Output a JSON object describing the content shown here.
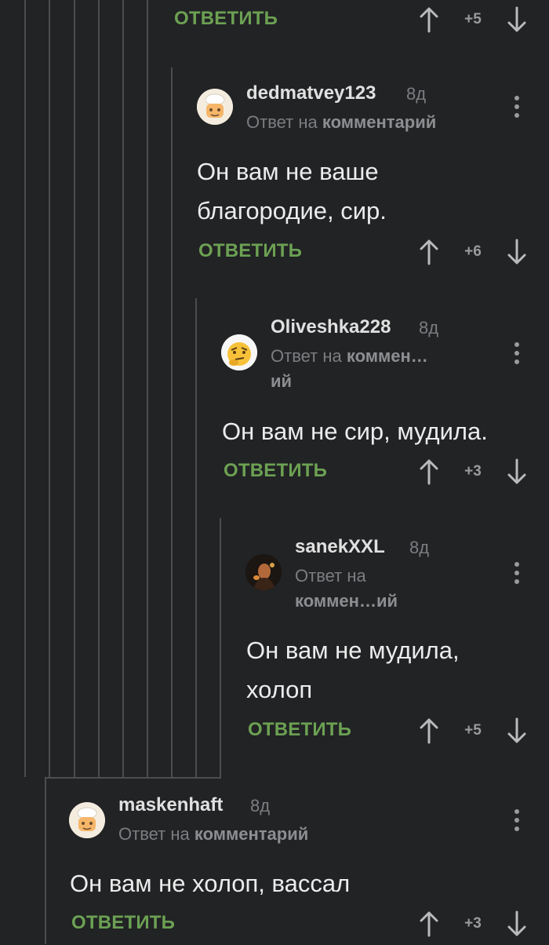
{
  "top_actions": {
    "reply": "ОТВЕТИТЬ",
    "score": "+5"
  },
  "comments": [
    {
      "author": "dedmatvey123",
      "time": "8д",
      "reply_prefix": "Ответ на",
      "reply_target": "комментарий",
      "text_lines": [
        "Он вам не ваше",
        "благородие, сир."
      ],
      "reply": "ОТВЕТИТЬ",
      "score": "+6",
      "avatar": "chef-avatar"
    },
    {
      "author": "Oliveshka228",
      "time": "8д",
      "reply_prefix": "Ответ на",
      "reply_target_line1": "коммен…",
      "reply_target_line2": "ий",
      "text_lines": [
        "Он вам не сир, мудила."
      ],
      "reply": "ОТВЕТИТЬ",
      "score": "+3",
      "avatar": "thinking-emoji-avatar"
    },
    {
      "author": "sanekXXL",
      "time": "8д",
      "reply_prefix": "Ответ на",
      "reply_target": "коммен…ий",
      "text_lines": [
        "Он вам не мудила,",
        "холоп"
      ],
      "reply": "ОТВЕТИТЬ",
      "score": "+5",
      "avatar": "photo-avatar"
    },
    {
      "author": "maskenhaft",
      "time": "8д",
      "reply_prefix": "Ответ на",
      "reply_target": "комментарий",
      "text_lines": [
        "Он вам не холоп, вассал"
      ],
      "reply": "ОТВЕТИТЬ",
      "score": "+3",
      "avatar": "chef-avatar"
    }
  ],
  "colors": {
    "background": "#222325",
    "reply": "#6ca153",
    "line": "#4c4d50",
    "muted": "#7c7d80"
  }
}
